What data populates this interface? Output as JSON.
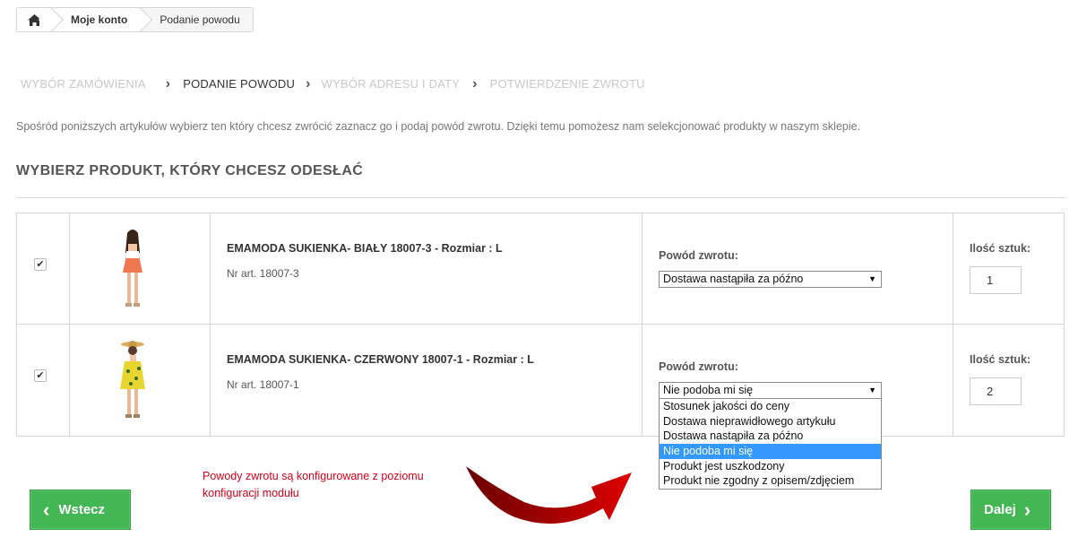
{
  "breadcrumb": {
    "home_icon": "home-icon",
    "items": [
      "Moje konto",
      "Podanie powodu"
    ]
  },
  "steps": [
    "WYBÓR ZAMÓWIENIA",
    "PODANIE POWODU",
    "WYBÓR ADRESU I DATY",
    "POTWIERDZENIE ZWROTU"
  ],
  "intro": "Spośród poniższych artykułów wybierz ten który chcesz zwrócić zaznacz go i podaj powód zwrotu. Dzięki temu pomożesz nam selekcjonować produkty w naszym sklepie.",
  "section_title": "WYBIERZ PRODUKT, KTÓRY CHCESZ ODESŁAĆ",
  "labels": {
    "reason": "Powód zwrotu:",
    "qty": "Ilość sztuk:"
  },
  "products": [
    {
      "name": "EMAMODA SUKIENKA- BIAŁY 18007-3 - Rozmiar : L",
      "ref": "Nr art. 18007-3",
      "reason": "Dostawa nastąpiła za późno",
      "qty": "1",
      "checked": "✔",
      "color": "#f07850"
    },
    {
      "name": "EMAMODA SUKIENKA- CZERWONY 18007-1 - Rozmiar : L",
      "ref": "Nr art. 18007-1",
      "reason": "Nie podoba mi się",
      "qty": "2",
      "checked": "✔",
      "color": "#e8d530"
    }
  ],
  "dropdown_options": [
    "Stosunek jakości do ceny",
    "Dostawa nieprawidłowego artykułu",
    "Dostawa nastąpiła za późno",
    "Nie podoba mi się",
    "Produkt jest uszkodzony",
    "Produkt nie zgodny z opisem/zdjęciem"
  ],
  "dropdown_selected": "Nie podoba mi się",
  "note": "Powody zwrotu są konfigurowane z poziomu konfiguracji modułu",
  "buttons": {
    "back": "Wstecz",
    "next": "Dalej"
  },
  "colors": {
    "accent": "#43b754",
    "note": "#d0021b",
    "selected_option": "#3399ff"
  }
}
